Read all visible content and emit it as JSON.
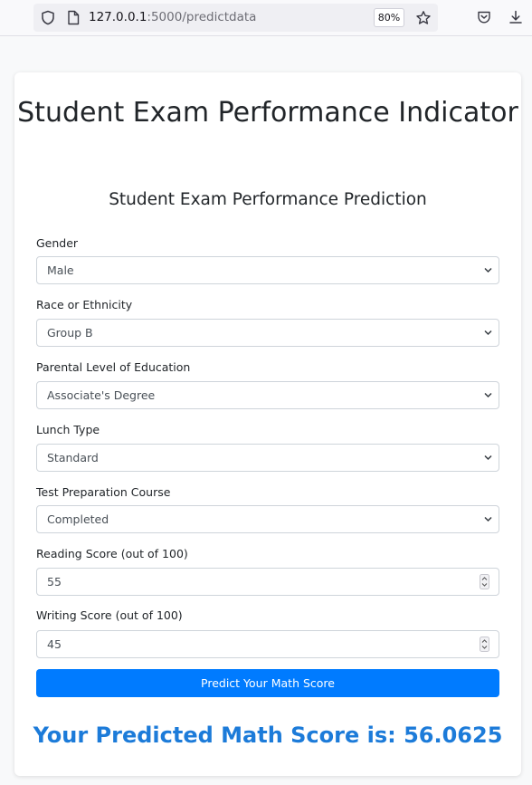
{
  "browser": {
    "url_host": "127.0.0.1",
    "url_path": ":5000/predictdata",
    "zoom": "80%"
  },
  "page": {
    "title": "Student Exam Performance Indicator",
    "subtitle": "Student Exam Performance Prediction"
  },
  "form": {
    "gender": {
      "label": "Gender",
      "value": "Male"
    },
    "ethnicity": {
      "label": "Race or Ethnicity",
      "value": "Group B"
    },
    "parental_education": {
      "label": "Parental Level of Education",
      "value": "Associate's Degree"
    },
    "lunch": {
      "label": "Lunch Type",
      "value": "Standard"
    },
    "test_prep": {
      "label": "Test Preparation Course",
      "value": "Completed"
    },
    "reading_score": {
      "label": "Reading Score (out of 100)",
      "value": "55"
    },
    "writing_score": {
      "label": "Writing Score (out of 100)",
      "value": "45"
    },
    "submit_label": "Predict Your Math Score"
  },
  "result": {
    "text": "Your Predicted Math Score is: 56.0625"
  },
  "colors": {
    "primary_button": "#007bff",
    "result_text": "#1c7bd9"
  },
  "icons": {
    "shield": "shield-icon",
    "page": "page-icon",
    "star": "bookmark-star-icon",
    "pocket": "pocket-icon",
    "download": "download-icon",
    "dropdown": "chevron-down-icon",
    "spinner": "number-spinner-icon"
  }
}
